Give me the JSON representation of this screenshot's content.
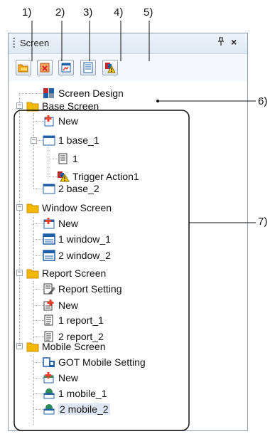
{
  "callouts": [
    "1)",
    "2)",
    "3)",
    "4)",
    "5)",
    "6)",
    "7)"
  ],
  "panel": {
    "title": "Screen",
    "pin_glyph": "ᵽ",
    "close_glyph": "×"
  },
  "toolbar": {
    "buttons": [
      {
        "icon": "open-folder-icon"
      },
      {
        "icon": "delete-screen-icon"
      },
      {
        "icon": "screen-image-icon"
      },
      {
        "icon": "properties-icon"
      },
      {
        "icon": "trigger-warning-icon"
      }
    ]
  },
  "tree": {
    "screen_design": "Screen Design",
    "base_screen": {
      "label": "Base Screen",
      "new": "New",
      "base1": "1 base_1",
      "base1_child": "1",
      "trigger": "Trigger Action1",
      "base2": "2 base_2"
    },
    "window_screen": {
      "label": "Window Screen",
      "new": "New",
      "window1": "1 window_1",
      "window2": "2 window_2"
    },
    "report_screen": {
      "label": "Report Screen",
      "setting": "Report Setting",
      "new": "New",
      "report1": "1 report_1",
      "report2": "2 report_2"
    },
    "mobile_screen": {
      "label": "Mobile Screen",
      "setting": "GOT Mobile Setting",
      "new": "New",
      "mobile1": "1 mobile_1",
      "mobile2": "2 mobile_2"
    }
  },
  "colors": {
    "folder": "#f5b800",
    "accent_blue": "#1f5fa8",
    "new_red": "#e8412c",
    "selection": "#dde6f2"
  }
}
